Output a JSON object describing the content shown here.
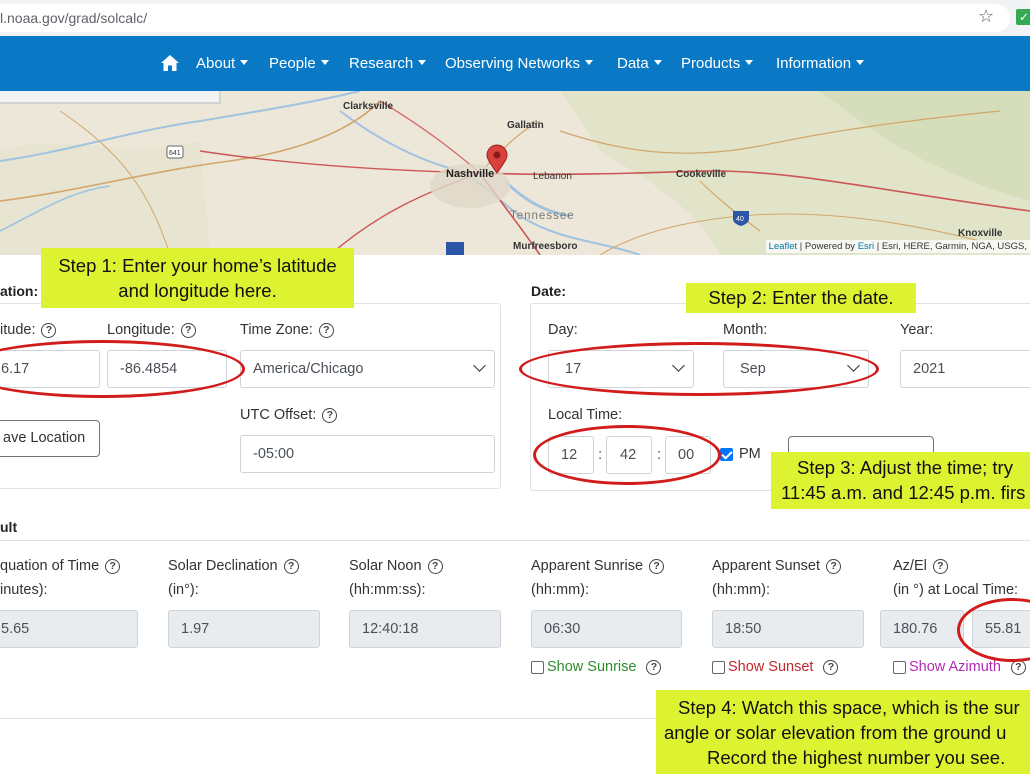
{
  "browser": {
    "url": "l.noaa.gov/grad/solcalc/"
  },
  "nav": {
    "items": [
      "About",
      "People",
      "Research",
      "Observing Networks",
      "Data",
      "Products",
      "Information"
    ]
  },
  "map": {
    "places": [
      "Clarksville",
      "Gallatin",
      "Nashville",
      "Lebanon",
      "Cookeville",
      "Tennessee",
      "Murfreesboro",
      "Knoxville"
    ],
    "shields": [
      "641",
      "40"
    ],
    "attribution_leaflet": "Leaflet",
    "attribution_mid": " | Powered by ",
    "attribution_esri": "Esri",
    "attribution_rest": " | Esri, HERE, Garmin, NGA, USGS,"
  },
  "location": {
    "section_label": "ation:",
    "lat_label": "itude:",
    "lat_value": "6.17",
    "lon_label": "Longitude:",
    "lon_value": "-86.4854",
    "tz_label": "Time Zone:",
    "tz_value": "America/Chicago",
    "utc_label": "UTC Offset:",
    "utc_value": "-05:00",
    "save_button": "ave Location"
  },
  "date": {
    "section_label": "Date:",
    "day_label": "Day:",
    "day_value": "17",
    "month_label": "Month:",
    "month_value": "Sep",
    "year_label": "Year:",
    "year_value": "2021",
    "local_time_label": "Local Time:",
    "hour": "12",
    "minute": "42",
    "second": "00",
    "pm_label": "PM",
    "pm_checked": true
  },
  "result": {
    "section_label": "ult",
    "eot_label_1": "quation of Time",
    "eot_label_2": "inutes):",
    "eot_value": "5.65",
    "decl_label_1": "Solar Declination",
    "decl_label_2": "(in°):",
    "decl_value": "1.97",
    "noon_label_1": "Solar Noon",
    "noon_label_2": "(hh:mm:ss):",
    "noon_value": "12:40:18",
    "sunrise_label_1": "Apparent Sunrise",
    "sunrise_label_2": "(hh:mm):",
    "sunrise_value": "06:30",
    "sunset_label_1": "Apparent Sunset",
    "sunset_label_2": "(hh:mm):",
    "sunset_value": "18:50",
    "azel_label_1": "Az/El",
    "azel_label_2": "(in °) at Local Time:",
    "az_value": "180.76",
    "el_value": "55.81",
    "show_sunrise": "Show Sunrise",
    "show_sunset": "Show Sunset",
    "show_azimuth": "Show Azimuth"
  },
  "notes": {
    "step1_line1": "Step 1: Enter your home’s latitude",
    "step1_line2": "and longitude here.",
    "step2": "Step 2: Enter the date.",
    "step3_line1": "Step 3: Adjust the time; try",
    "step3_line2": "11:45 a.m. and 12:45 p.m. firs",
    "step4_line1": "Step 4: Watch this space, which is the sur",
    "step4_line2": "angle or solar elevation from the ground u",
    "step4_line3": "Record the highest number you see."
  },
  "colors": {
    "nav": "#0a79c5",
    "note": "#ddf230",
    "oval": "#d21b1b",
    "sunrise": "#2e8b2e",
    "sunset": "#c0282d",
    "azimuth": "#b42bb4"
  }
}
